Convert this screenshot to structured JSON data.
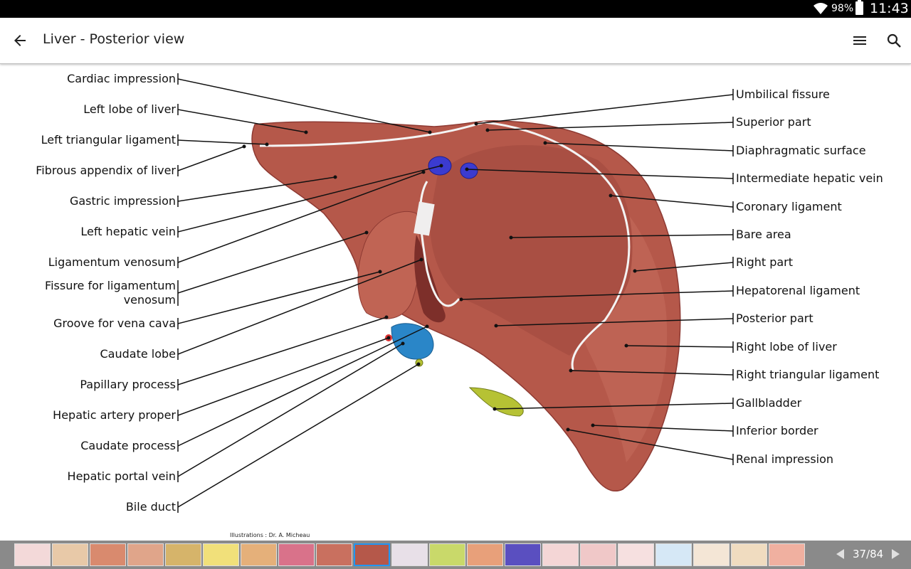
{
  "status": {
    "battery": "98%",
    "time": "11:43"
  },
  "appbar": {
    "title": "Liver - Posterior view"
  },
  "diagram": {
    "left_labels": [
      "Cardiac impression",
      "Left lobe of liver",
      "Left triangular ligament",
      "Fibrous appendix of liver",
      "Gastric impression",
      "Left hepatic vein",
      "Ligamentum venosum",
      "Fissure for ligamentum",
      "venosum",
      "Groove for vena cava",
      "Caudate lobe",
      "Papillary process",
      "Hepatic artery proper",
      "Caudate process",
      "Hepatic portal vein",
      "Bile duct"
    ],
    "right_labels": [
      "Umbilical fissure",
      "Superior part",
      "Diaphragmatic surface",
      "Intermediate hepatic vein",
      "Coronary ligament",
      "Bare area",
      "Right part",
      "Hepatorenal ligament",
      "Posterior part",
      "Right lobe of liver",
      "Right triangular ligament",
      "Gallbladder",
      "Inferior border",
      "Renal impression"
    ],
    "credit": "Illustrations : Dr. A. Micheau",
    "colors": {
      "liver": "#b5584a",
      "liver_dark": "#8e3a33",
      "vein": "#3b3bd0",
      "portal": "#2a86c8",
      "gallbladder": "#b6c234"
    }
  },
  "thumbnails": {
    "count_visible": 21,
    "active_index": 9
  },
  "pager": {
    "text": "37/84"
  }
}
